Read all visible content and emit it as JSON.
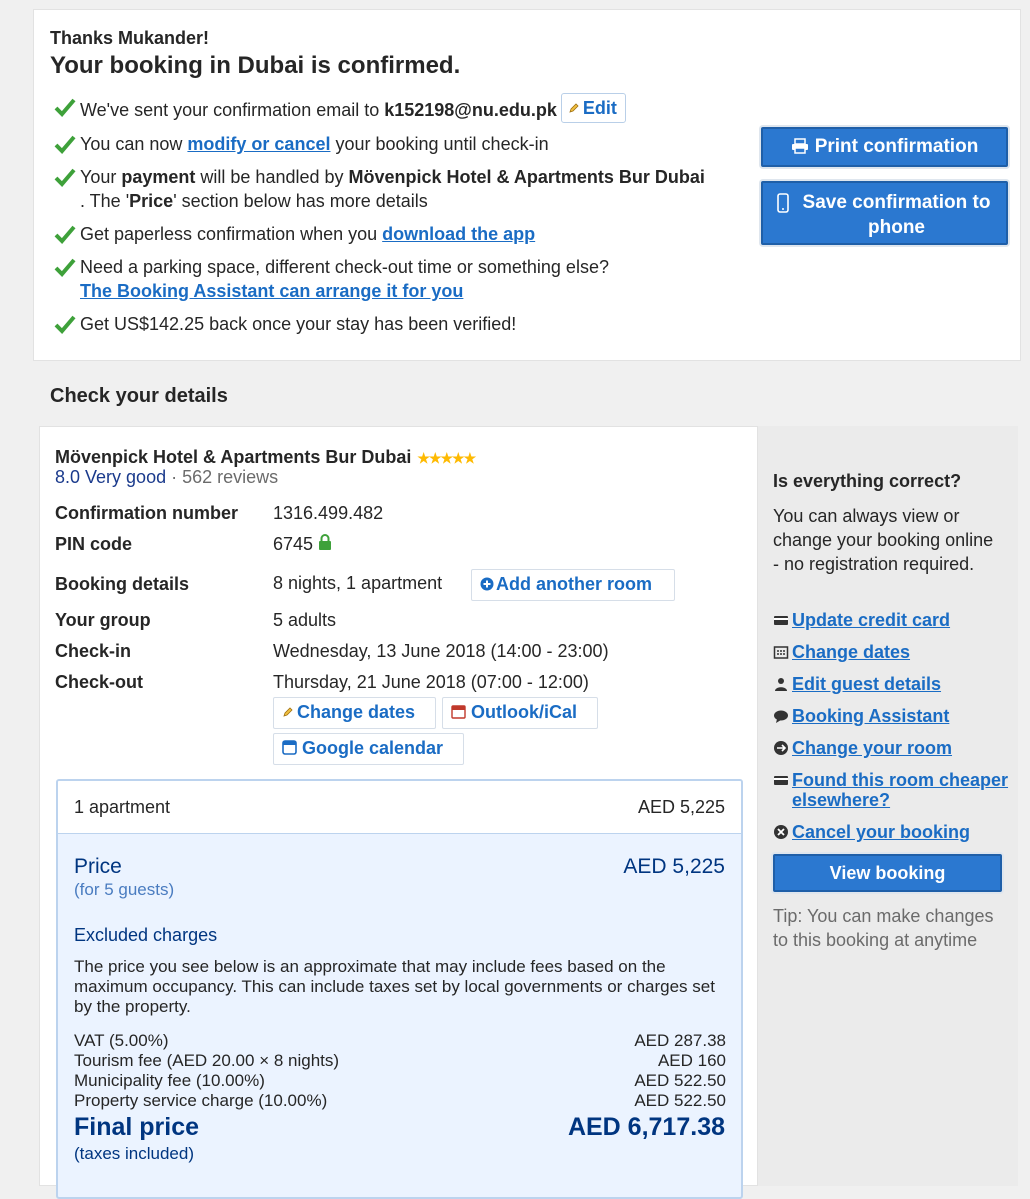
{
  "confirmation": {
    "thanks": "Thanks Mukander!",
    "title": "Your booking in Dubai is confirmed.",
    "lines": {
      "email_prefix": "We've sent your confirmation email to ",
      "email": "k152198@nu.edu.pk",
      "edit_label": "Edit",
      "modify_prefix": "You can now ",
      "modify_link": "modify or cancel",
      "modify_suffix": " your booking until check-in",
      "payment_prefix": "Your ",
      "payment_bold": "payment",
      "payment_mid": " will be handled by ",
      "payment_hotel": "Mövenpick Hotel & Apartments Bur Dubai",
      "payment_suffix_a": " . The '",
      "payment_price_word": "Price",
      "payment_suffix_b": "' section below has more details",
      "paperless_prefix": "Get paperless confirmation when you ",
      "paperless_link": "download the app",
      "parking_text": "Need a parking space, different check-out time or something else?",
      "parking_link": "The Booking Assistant can arrange it for you",
      "cashback": "Get US$142.25 back once your stay has been verified!"
    },
    "print_button": "Print confirmation",
    "save_button": "Save confirmation to phone"
  },
  "details": {
    "section_title": "Check your details",
    "hotel_name": "Mövenpick Hotel & Apartments Bur Dubai",
    "stars": "★★★★★",
    "rating_score": "8.0 Very good",
    "rating_sep": " · ",
    "reviews": "562 reviews",
    "rows": {
      "confirmation_label": "Confirmation number",
      "confirmation_value": "1316.499.482",
      "pin_label": "PIN code",
      "pin_value": "6745",
      "booking_label": "Booking details",
      "booking_value": "8 nights, 1 apartment",
      "add_room": "Add another room",
      "group_label": "Your group",
      "group_value": "5 adults",
      "checkin_label": "Check-in",
      "checkin_value": "Wednesday, 13 June 2018 (14:00 - 23:00)",
      "checkout_label": "Check-out",
      "checkout_value": "Thursday, 21 June 2018 (07:00 - 12:00)"
    },
    "chips": {
      "change_dates": "Change dates",
      "outlook": "Outlook/iCal",
      "google": "Google calendar"
    }
  },
  "price": {
    "apartment_label": "1 apartment",
    "apartment_amount": "AED 5,225",
    "price_label": "Price",
    "price_sub": "(for 5 guests)",
    "price_amount": "AED 5,225",
    "excluded_title": "Excluded charges",
    "excluded_desc": "The price you see below is an approximate that may include fees based on the maximum occupancy. This can include taxes set by local governments or charges set by the property.",
    "charges": [
      {
        "label": "VAT  (5.00%)",
        "amount": "AED 287.38"
      },
      {
        "label": "Tourism fee  (AED 20.00 × 8 nights)",
        "amount": "AED 160"
      },
      {
        "label": "Municipality fee  (10.00%)",
        "amount": "AED 522.50"
      },
      {
        "label": "Property service charge  (10.00%)",
        "amount": "AED 522.50"
      }
    ],
    "final_label": "Final price",
    "final_amount": "AED 6,717.38",
    "final_sub": "(taxes included)"
  },
  "sidebar": {
    "question": "Is everything correct?",
    "paragraph": "You can always view or change your booking online - no registration required.",
    "links": [
      {
        "label": "Update credit card",
        "icon": "credit-card-icon"
      },
      {
        "label": "Change dates",
        "icon": "calendar-icon"
      },
      {
        "label": "Edit guest details",
        "icon": "person-icon"
      },
      {
        "label": "Booking Assistant",
        "icon": "chat-icon"
      },
      {
        "label": "Change your room",
        "icon": "swap-icon"
      },
      {
        "label": "Found this room cheaper elsewhere?",
        "icon": "price-tag-icon"
      },
      {
        "label": "Cancel your booking",
        "icon": "cancel-icon"
      }
    ],
    "view_button": "View booking",
    "tip": "Tip: You can make changes to this booking at anytime"
  },
  "colors": {
    "link": "#1a6cc4",
    "button": "#2b78d0",
    "check": "#3ea13a",
    "price_text": "#003580",
    "price_bg": "#ebf3ff"
  }
}
